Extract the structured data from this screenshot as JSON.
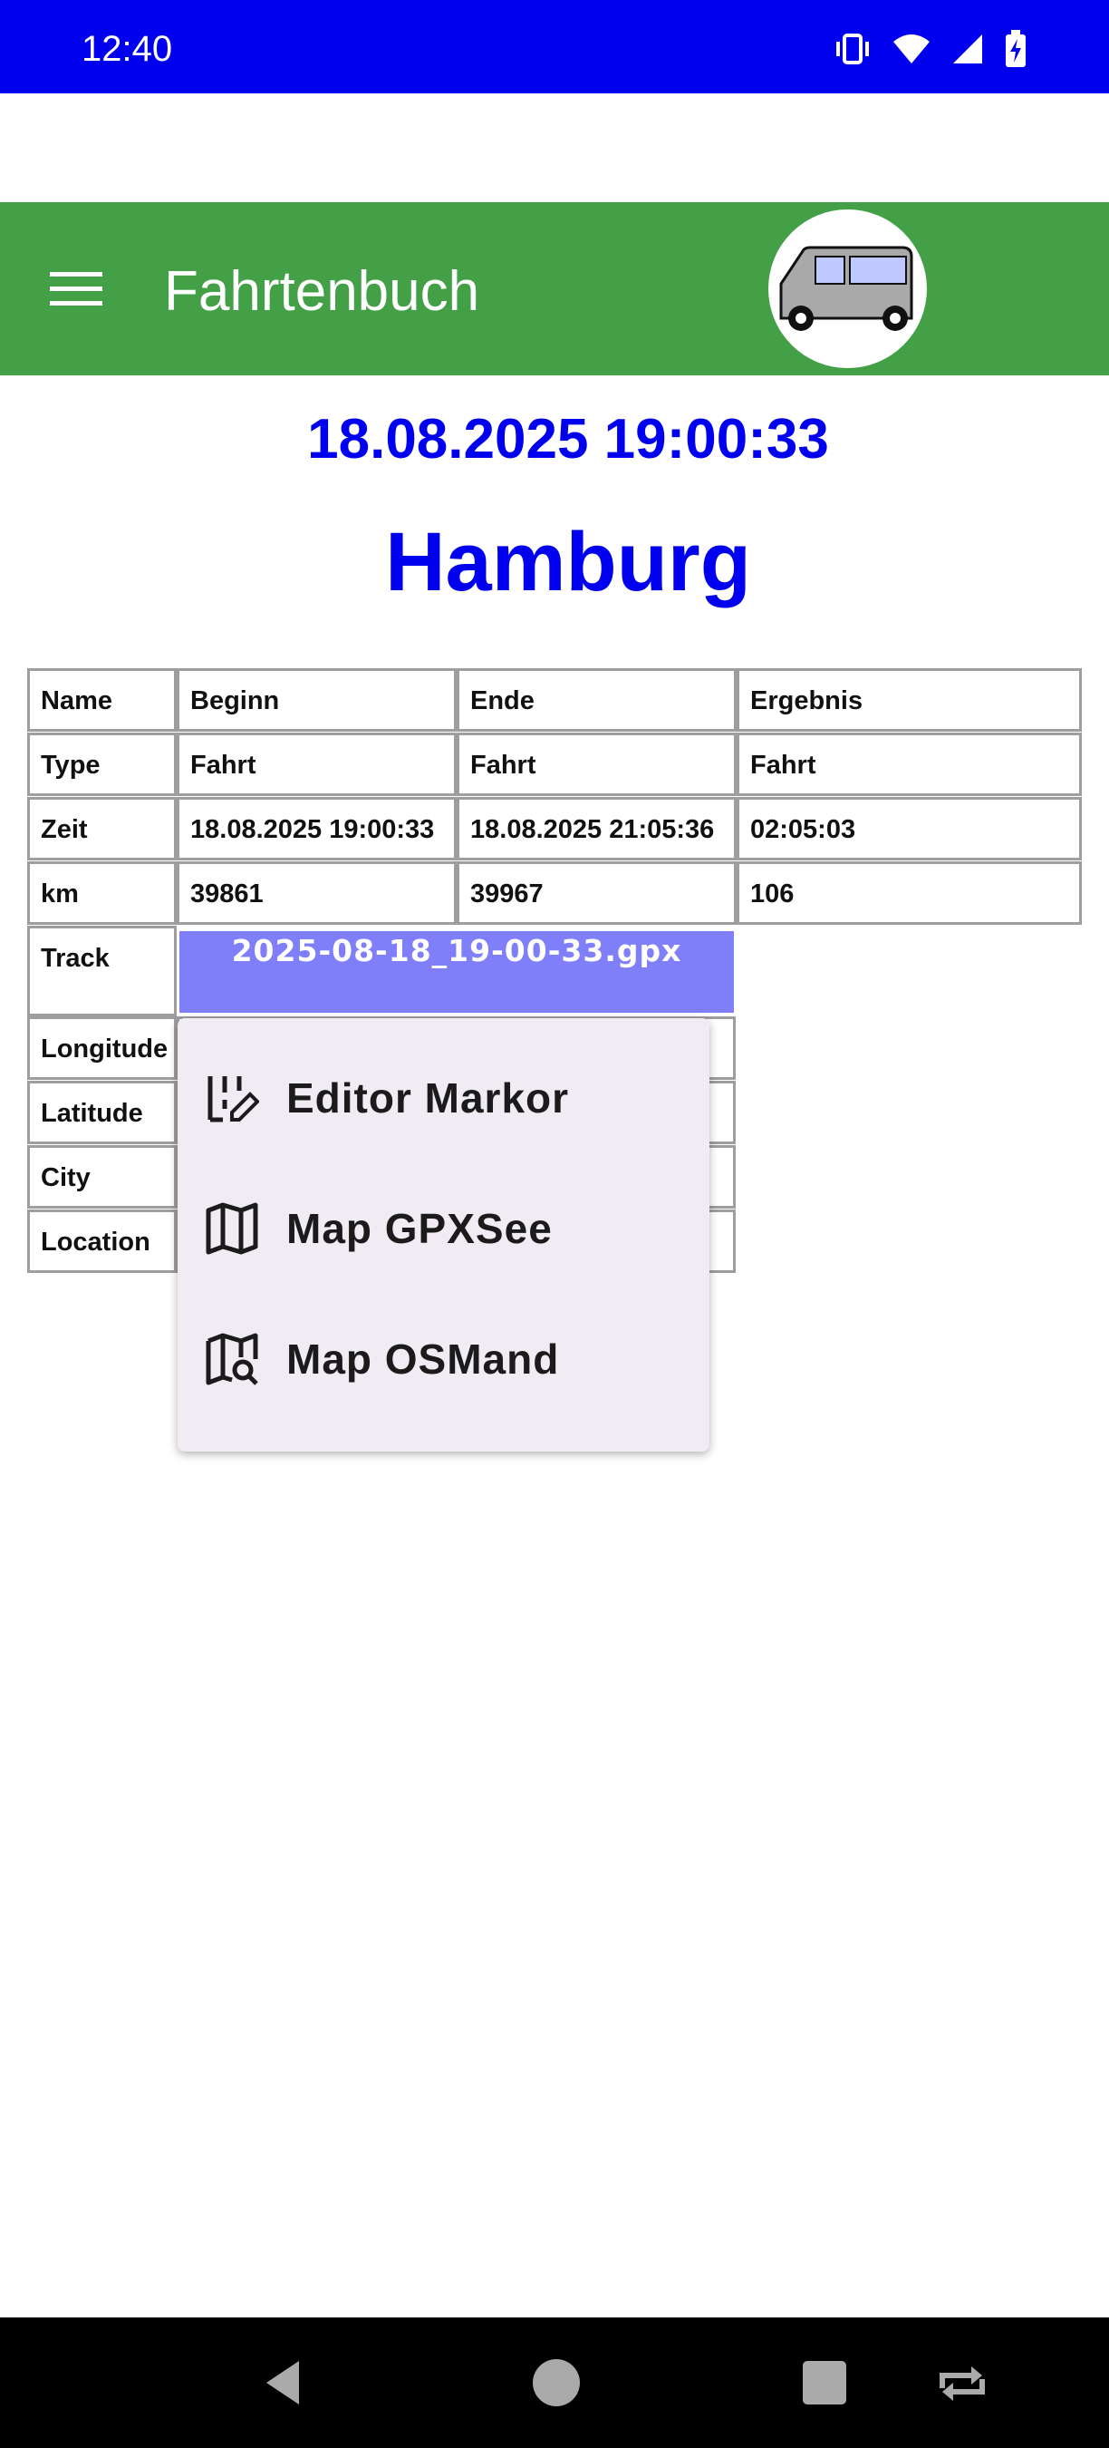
{
  "status_bar": {
    "time": "12:40",
    "icons": [
      "vibrate-icon",
      "wifi-icon",
      "signal-icon",
      "battery-charging-icon"
    ]
  },
  "app_bar": {
    "title": "Fahrtenbuch",
    "menu_icon": "hamburger-menu-icon",
    "logo_icon": "van-icon",
    "color": "#43a047"
  },
  "header": {
    "datetime": "18.08.2025 19:00:33",
    "city": "Hamburg",
    "color": "#0000ee"
  },
  "table": {
    "columns": [
      "Name",
      "Beginn",
      "Ende",
      "Ergebnis"
    ],
    "rows": [
      [
        "Type",
        "Fahrt",
        "Fahrt",
        "Fahrt"
      ],
      [
        "Zeit",
        "18.08.2025 19:00:33",
        "18.08.2025 21:05:36",
        "02:05:03"
      ],
      [
        "km",
        "39861",
        "39967",
        "106"
      ]
    ],
    "track": {
      "label": "Track",
      "file": "2025-08-18_19-00-33.gpx",
      "color": "#7f7ff9"
    },
    "labels_below": [
      "Longitude",
      "Latitude",
      "City",
      "Location"
    ]
  },
  "popup_menu": {
    "items": [
      {
        "label": "Editor Markor",
        "icon": "edit-document-icon"
      },
      {
        "label": "Map GPXSee",
        "icon": "map-icon"
      },
      {
        "label": "Map OSMand",
        "icon": "map-search-icon"
      }
    ]
  },
  "nav_bar": {
    "buttons": [
      "back-icon",
      "home-icon",
      "recents-icon",
      "rotate-icon"
    ]
  }
}
